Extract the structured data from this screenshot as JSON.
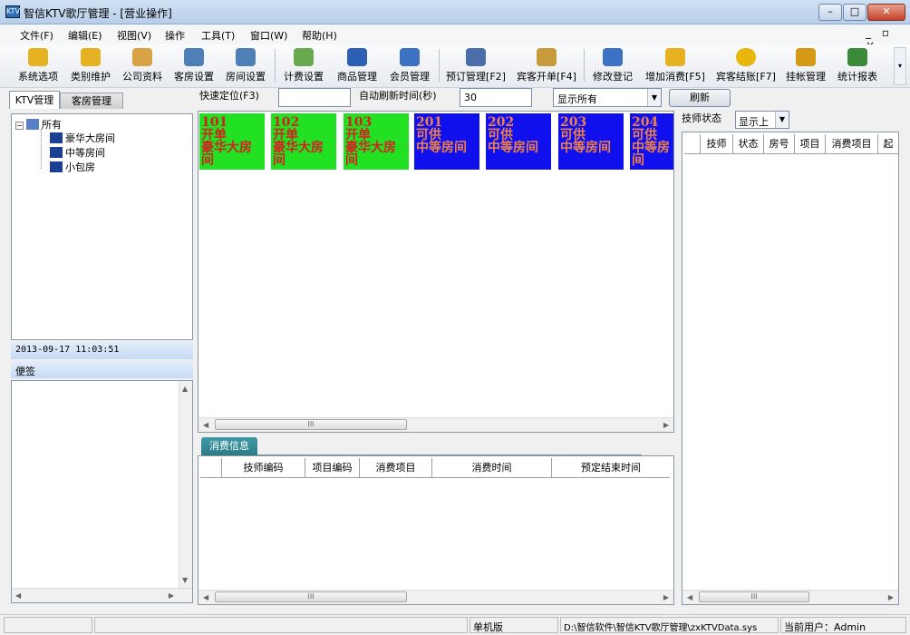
{
  "window": {
    "title": "智信KTV歌厅管理 - [营业操作]",
    "icon_text": "KTV"
  },
  "menu": [
    "文件(F)",
    "编辑(E)",
    "视图(V)",
    "操作",
    "工具(T)",
    "窗口(W)",
    "帮助(H)"
  ],
  "mdi_controls": "_ ▫ ×",
  "toolbar": [
    {
      "label": "系统选项",
      "icon": "key-icon"
    },
    {
      "label": "类别维护",
      "icon": "key-icon"
    },
    {
      "label": "公司资料",
      "icon": "books-icon"
    },
    {
      "label": "客房设置",
      "icon": "building-icon"
    },
    {
      "label": "房间设置",
      "icon": "building-icon"
    },
    {
      "label": "计费设置",
      "icon": "money-icon"
    },
    {
      "label": "商品管理",
      "icon": "cube-icon"
    },
    {
      "label": "会员管理",
      "icon": "person-icon"
    },
    {
      "label": "预订管理[F2]",
      "icon": "phone-icon"
    },
    {
      "label": "宾客开单[F4]",
      "icon": "box-icon"
    },
    {
      "label": "修改登记",
      "icon": "person-edit-icon"
    },
    {
      "label": "增加消费[F5]",
      "icon": "add-icon"
    },
    {
      "label": "宾客结账[F7]",
      "icon": "coin-icon"
    },
    {
      "label": "挂帐管理",
      "icon": "moneybag-icon"
    },
    {
      "label": "统计报表",
      "icon": "bar-chart-icon"
    }
  ],
  "tabs": {
    "ktv": "KTV管理",
    "guest": "客房管理"
  },
  "controls": {
    "quick_label": "快速定位(F3)",
    "quick_value": "",
    "refresh_label": "自动刷新时间(秒)",
    "refresh_value": "30",
    "filter_value": "显示所有",
    "refresh_button": "刷新"
  },
  "tree": {
    "root": "所有",
    "children": [
      "豪华大房间",
      "中等房间",
      "小包房"
    ]
  },
  "datetime": "2013-09-17 11:03:51",
  "memo_label": "便签",
  "rooms": [
    {
      "number": "101",
      "status": "开单",
      "type": "豪华大房间",
      "state": "busy"
    },
    {
      "number": "102",
      "status": "开单",
      "type": "豪华大房间",
      "state": "busy"
    },
    {
      "number": "103",
      "status": "开单",
      "type": "豪华大房间",
      "state": "busy"
    },
    {
      "number": "201",
      "status": "可供",
      "type": "中等房间",
      "state": "free"
    },
    {
      "number": "202",
      "status": "可供",
      "type": "中等房间",
      "state": "free"
    },
    {
      "number": "203",
      "status": "可供",
      "type": "中等房间",
      "state": "free"
    },
    {
      "number": "204",
      "status": "可供",
      "type": "中等房间",
      "state": "free"
    }
  ],
  "consume": {
    "tab": "消费信息",
    "columns": [
      "技师编码",
      "项目编码",
      "消费项目",
      "消费时间",
      "预定结束时间"
    ],
    "rows": []
  },
  "tech": {
    "label": "技师状态",
    "select_value": "显示上",
    "columns": [
      "技师",
      "状态",
      "房号",
      "项目",
      "消费项目",
      "起"
    ],
    "rows": []
  },
  "statusbar": {
    "mode": "单机版",
    "path": "D:\\智信软件\\智信KTV歌厅管理\\zxKTVData.sys",
    "user": "当前用户：Admin"
  },
  "colors": {
    "room_busy_bg": "#22e022",
    "room_busy_text": "#d42020",
    "room_free_bg": "#1010ee",
    "room_free_text": "#f0804a",
    "tab_accent": "#2c7b87"
  }
}
